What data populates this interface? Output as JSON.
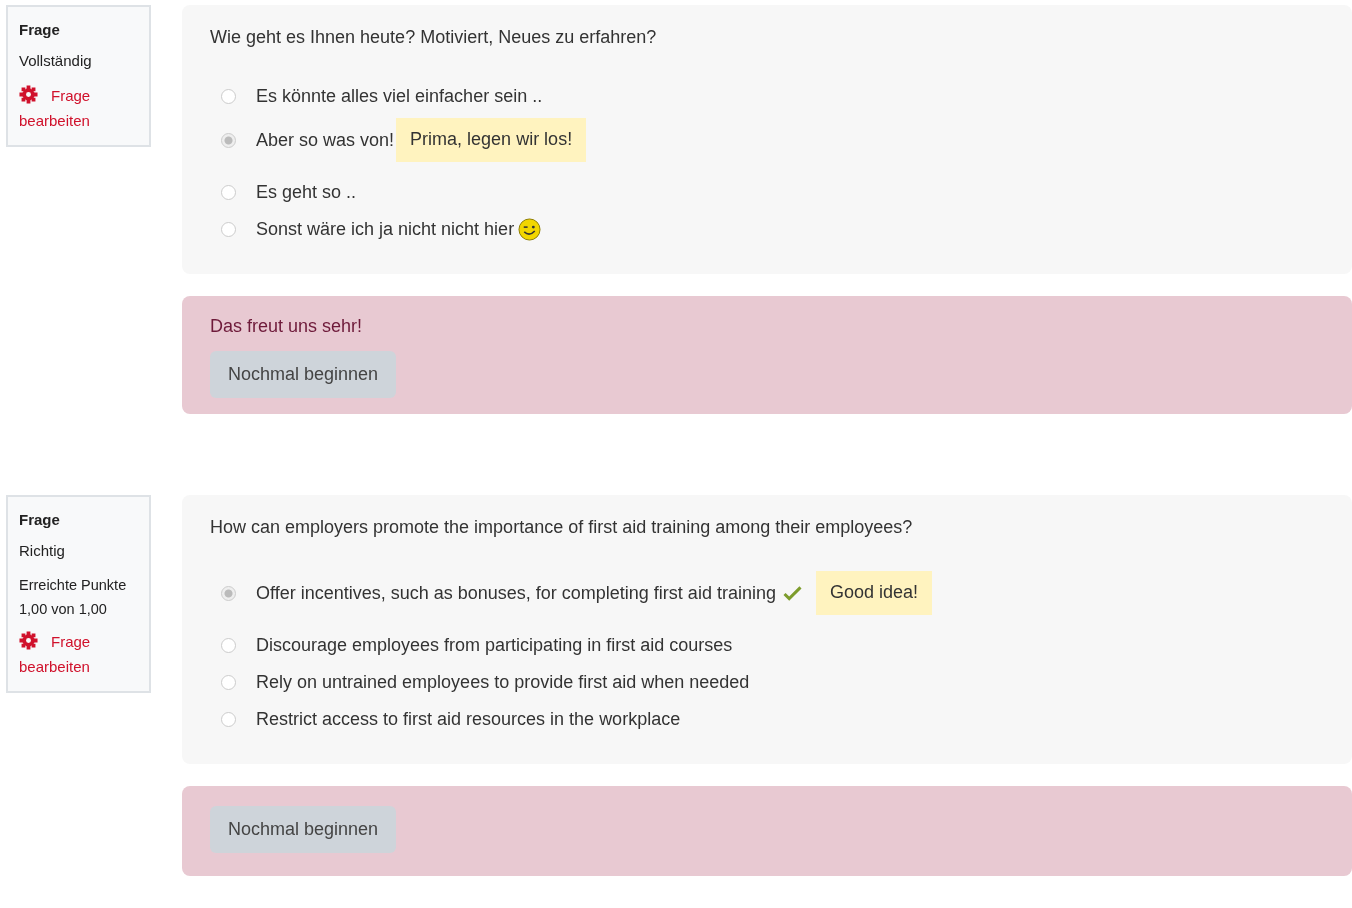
{
  "questions": [
    {
      "info": {
        "title": "Frage",
        "state": "Vollständig",
        "edit_link": "Frage bearbeiten"
      },
      "prompt": "Wie geht es Ihnen heute? Motiviert, Neues zu erfahren?",
      "options": [
        {
          "label": "Es könnte alles viel einfacher sein ..",
          "selected": false,
          "correct": false
        },
        {
          "label": "Aber so was von!",
          "selected": true,
          "correct": false,
          "feedback": "Prima, legen wir los!"
        },
        {
          "label": "Es geht so ..",
          "selected": false,
          "correct": false
        },
        {
          "label": "Sonst wäre ich ja nicht nicht hier",
          "selected": false,
          "correct": false,
          "emoticon": true
        }
      ],
      "general_feedback": "Das freut uns sehr!",
      "restart_button": "Nochmal beginnen"
    },
    {
      "info": {
        "title": "Frage",
        "state": "Richtig",
        "points": [
          "Erreichte Punkte",
          "1,00 von 1,00"
        ],
        "edit_link": "Frage bearbeiten"
      },
      "prompt": "How can employers promote the importance of first aid training among their employees?",
      "options": [
        {
          "label": "Offer incentives, such as bonuses, for completing first aid training",
          "selected": true,
          "correct": true,
          "feedback": "Good idea!"
        },
        {
          "label": "Discourage employees from participating in first aid courses",
          "selected": false,
          "correct": false
        },
        {
          "label": "Rely on untrained employees to provide first aid when needed",
          "selected": false,
          "correct": false
        },
        {
          "label": "Restrict access to first aid resources in the workplace",
          "selected": false,
          "correct": false
        }
      ],
      "restart_button": "Nochmal beginnen"
    }
  ]
}
